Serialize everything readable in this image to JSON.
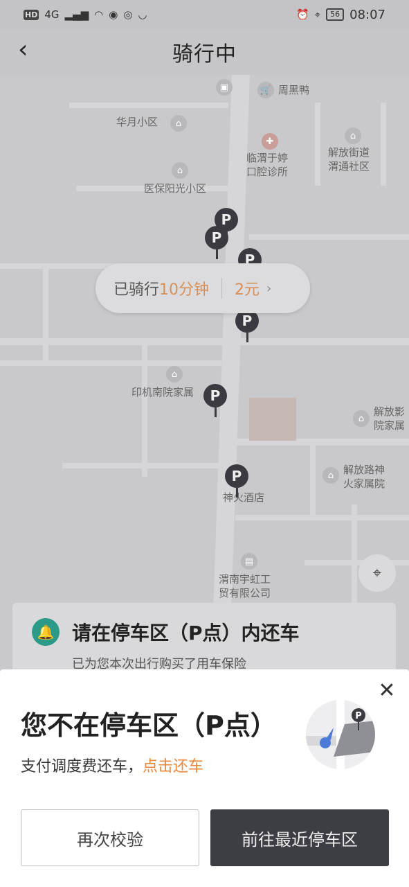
{
  "status_bar": {
    "network": "HD",
    "signal": "4G",
    "time": "08:07",
    "battery": "56"
  },
  "header": {
    "title": "骑行中"
  },
  "map": {
    "pois": [
      {
        "label": "周黑鸭"
      },
      {
        "label": "华月小区"
      },
      {
        "label": "临渭于婷"
      },
      {
        "label": "口腔诊所"
      },
      {
        "label": "解放街道"
      },
      {
        "label": "渭通社区"
      },
      {
        "label": "医保阳光小区"
      },
      {
        "label": "印机南院家属"
      },
      {
        "label": "解放影"
      },
      {
        "label": "院家属"
      },
      {
        "label": "解放路神"
      },
      {
        "label": "火家属院"
      },
      {
        "label": "神火酒店"
      },
      {
        "label": "渭南宇虹工"
      },
      {
        "label": "贸有限公司"
      }
    ],
    "parking_pin_label": "P"
  },
  "ride": {
    "prefix": "已骑行",
    "duration": "10分钟",
    "fare": "2元",
    "chevron": "›"
  },
  "notice": {
    "title": "请在停车区（P点）内还车",
    "subtitle": "已为您本次出行购买了用车保险"
  },
  "sheet": {
    "title": "您不在停车区（P点）",
    "subtitle_text": "支付调度费还车，",
    "subtitle_link": "点击还车",
    "btn_verify": "再次校验",
    "btn_goto": "前往最近停车区",
    "close": "✕"
  },
  "colors": {
    "accent_orange": "#e6883c",
    "bell_green": "#2c9a89",
    "dark_button": "#3d3d44"
  }
}
